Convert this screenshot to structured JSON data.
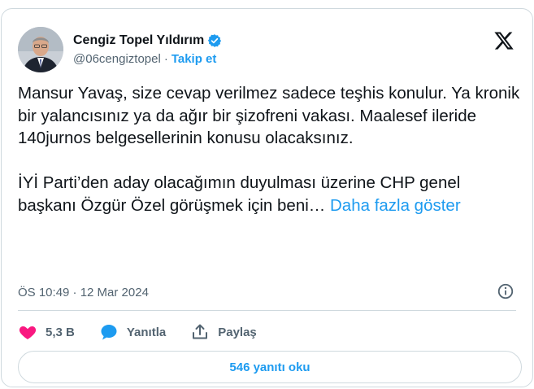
{
  "author": {
    "name": "Cengiz Topel Yıldırım",
    "handle": "@06cengiztopel",
    "separator": "·",
    "follow_label": "Takip et"
  },
  "tweet": {
    "text": "Mansur Yavaş, size cevap verilmez sadece teşhis konulur. Ya kronik bir yalancısınız ya da ağır bir şizofreni vakası. Maalesef ileride 140jurnos belgesellerinin konusu olacaksınız.\n\nİYİ Parti’den aday olacağımın duyulması üzerine CHP genel başkanı Özgür Özel görüşmek için beni… ",
    "show_more": "Daha fazla göster",
    "timestamp": "ÖS 10:49 · 12 Mar 2024"
  },
  "actions": {
    "like_count": "5,3 B",
    "reply_label": "Yanıtla",
    "share_label": "Paylaş"
  },
  "read_replies_label": "546 yanıtı oku",
  "colors": {
    "accent": "#1d9bf0",
    "like": "#f91880",
    "text": "#0f1419",
    "secondary": "#536471",
    "border": "#cfd9de"
  },
  "icons": {
    "verified": "verified-badge-icon",
    "brand": "x-logo-icon",
    "info": "info-icon",
    "like": "heart-icon",
    "reply": "speech-bubble-icon",
    "share": "share-upload-icon"
  }
}
